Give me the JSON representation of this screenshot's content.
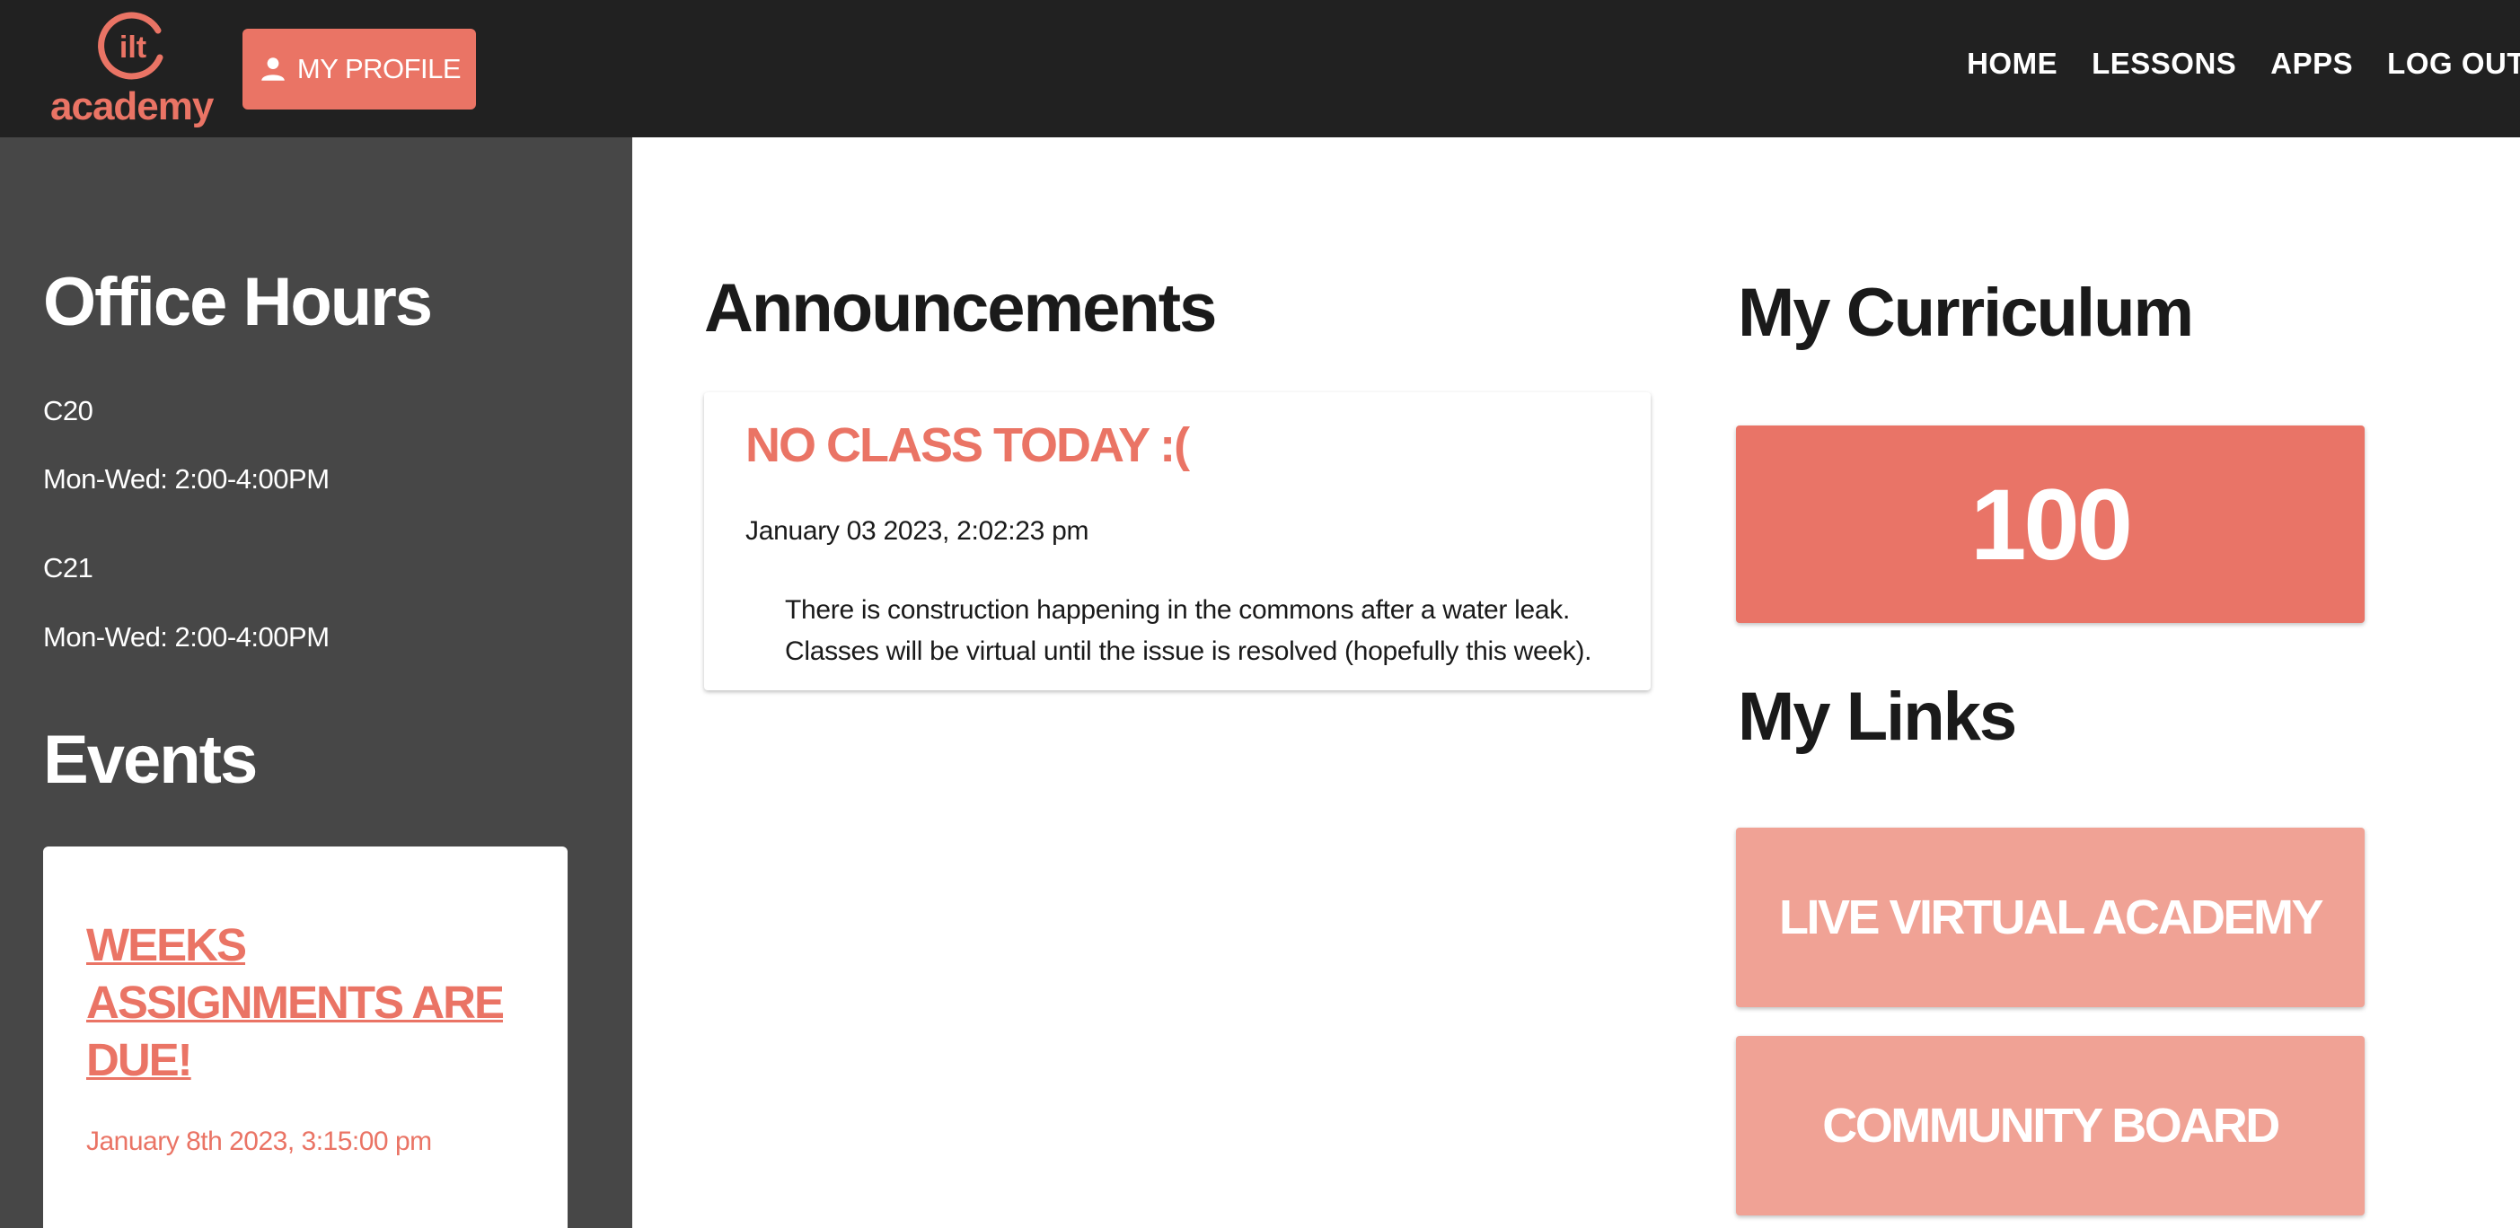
{
  "header": {
    "logo_text": "academy",
    "logo_mark": "ilt",
    "profile_button": "MY PROFILE",
    "nav": [
      "HOME",
      "LESSONS",
      "APPS",
      "LOG OUT"
    ]
  },
  "sidebar": {
    "office_hours_title": "Office Hours",
    "office_hours": [
      {
        "room": "C20",
        "hours": "Mon-Wed: 2:00-4:00PM"
      },
      {
        "room": "C21",
        "hours": "Mon-Wed: 2:00-4:00PM"
      }
    ],
    "events_title": "Events",
    "events": [
      {
        "title": "WEEKS ASSIGNMENTS ARE DUE!",
        "date": "January 8th 2023, 3:15:00 pm"
      }
    ]
  },
  "announcements": {
    "title": "Announcements",
    "items": [
      {
        "headline": "NO CLASS TODAY :(",
        "date": "January 03 2023, 2:02:23 pm",
        "body_line1": "There is construction happening in the commons after a water leak.",
        "body_line2": "Classes will be virtual until the issue is resolved (hopefully this week)."
      }
    ]
  },
  "curriculum": {
    "title": "My Curriculum",
    "value": "100"
  },
  "links": {
    "title": "My Links",
    "items": [
      "LIVE VIRTUAL ACADEMY",
      "COMMUNITY BOARD"
    ]
  },
  "colors": {
    "accent": "#ea7465",
    "accent_light": "#f0a295",
    "topbar": "#212121",
    "sidebar": "#474747"
  },
  "icons": {
    "profile_button": "person-icon",
    "logo": "ilt-logo-icon"
  }
}
